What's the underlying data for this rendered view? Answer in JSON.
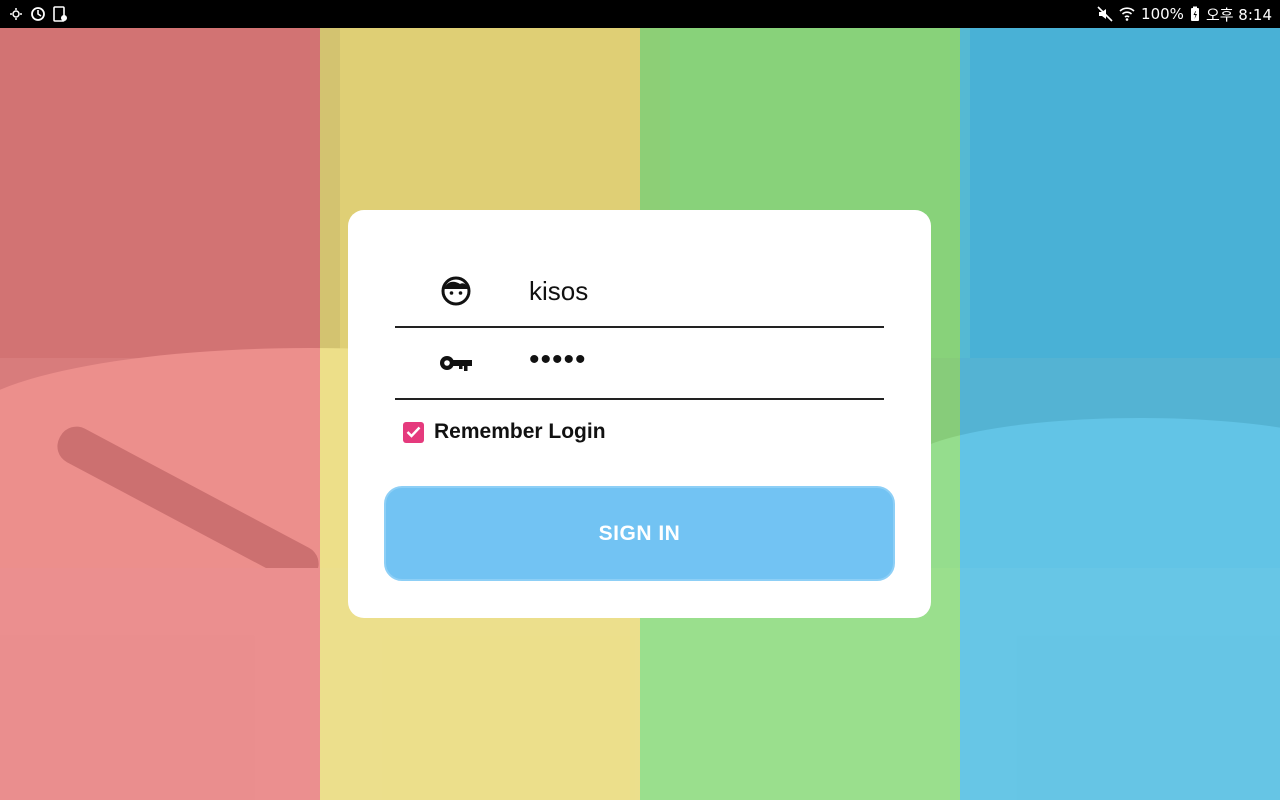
{
  "status_bar": {
    "battery": "100%",
    "time": "오후 8:14",
    "left_icons": [
      "screen-mirror-icon",
      "sync-icon",
      "device-icon"
    ],
    "right_icons": [
      "mute-icon",
      "wifi-icon",
      "battery-icon"
    ]
  },
  "background": {
    "stripe_colors": [
      "#f08080",
      "#f2e27c",
      "#8ee27e",
      "#4fc3ea"
    ]
  },
  "login": {
    "username": {
      "icon": "face-icon",
      "value": "kisos"
    },
    "password": {
      "icon": "key-icon",
      "masked_value": "•••••"
    },
    "remember": {
      "label": "Remember Login",
      "checked": true,
      "color": "#e53a7d"
    },
    "sign_in_label": "SIGN IN",
    "button_color": "#72c3f3"
  }
}
